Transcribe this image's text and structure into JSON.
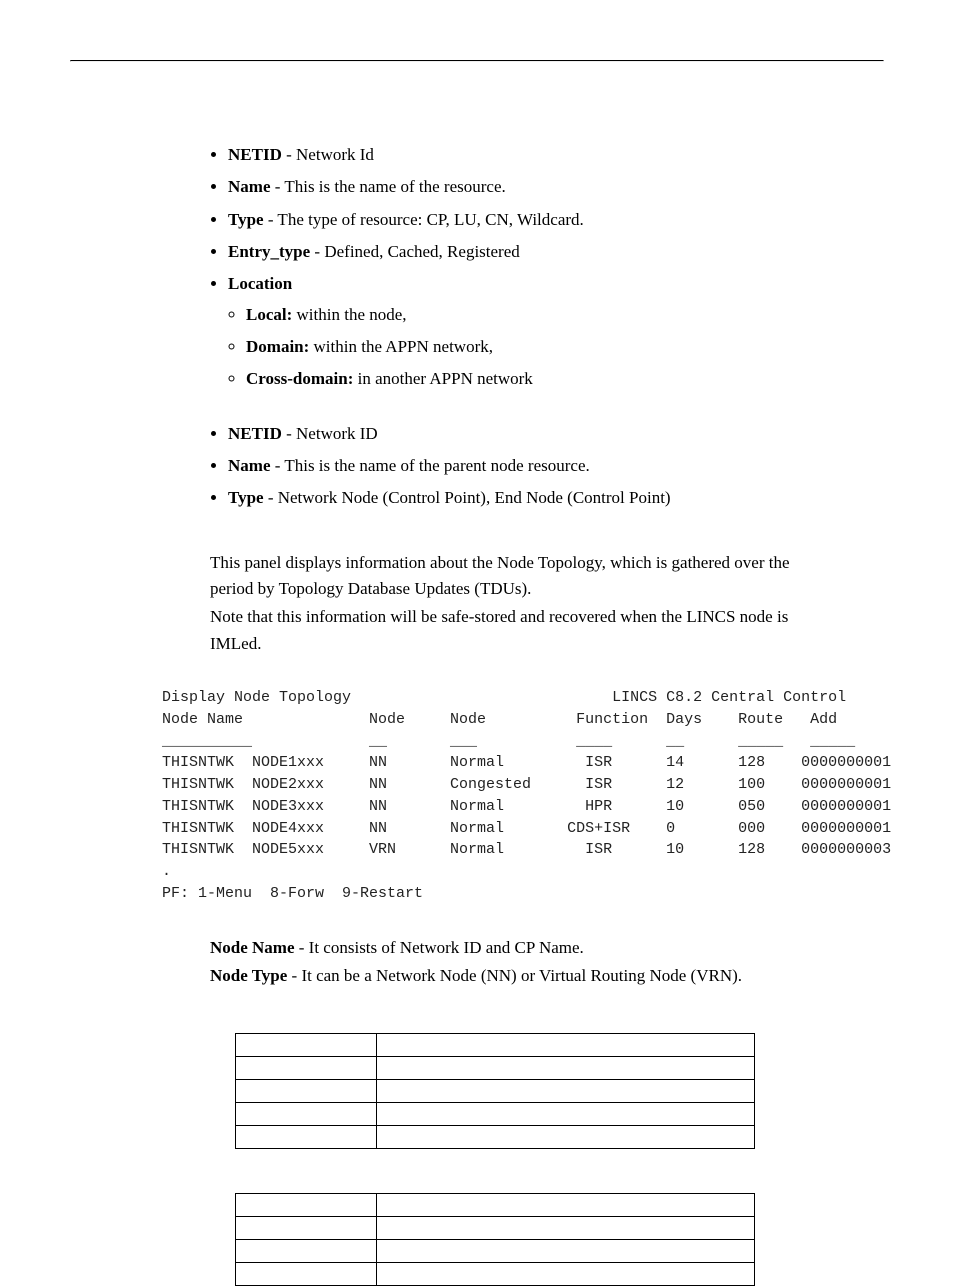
{
  "list1": {
    "items": [
      {
        "term": "NETID",
        "text": " - Network Id"
      },
      {
        "term": "Name",
        "text": " - This is the name of the resource."
      },
      {
        "term": "Type",
        "text": " - The type of resource: CP, LU, CN, Wildcard."
      },
      {
        "term": "Entry_type",
        "text": " - Defined, Cached, Registered"
      },
      {
        "term": "Location",
        "sub": [
          {
            "term": "Local:",
            "text": " within the node,"
          },
          {
            "term": "Domain:",
            "text": " within the APPN network,"
          },
          {
            "term": "Cross-domain:",
            "text": " in another APPN network"
          }
        ]
      }
    ]
  },
  "list2": {
    "items": [
      {
        "term": "NETID",
        "text": " - Network ID"
      },
      {
        "term": "Name",
        "text": " - This is the name of the parent node resource."
      },
      {
        "term": "Type",
        "text": " - Network Node (Control Point), End Node (Control Point)"
      }
    ]
  },
  "paragraph1": "This panel displays information about the Node Topology, which is gathered over the period by Topology Database Updates (TDUs).",
  "paragraph2": "Note that this information will be safe-stored and recovered when the LINCS node is IMLed.",
  "terminal": {
    "title_left": "Display Node Topology",
    "title_right": "LINCS C8.2 Central Control",
    "headers": [
      "Node Name",
      "Node",
      "Node",
      "Function",
      "Days",
      "Route",
      "Add"
    ],
    "rows": [
      [
        "THISNTWK",
        "NODE1xxx",
        "NN",
        "Normal",
        "ISR",
        "14",
        "128",
        "0000000001"
      ],
      [
        "THISNTWK",
        "NODE2xxx",
        "NN",
        "Congested",
        "ISR",
        "12",
        "100",
        "0000000001"
      ],
      [
        "THISNTWK",
        "NODE3xxx",
        "NN",
        "Normal",
        "HPR",
        "10",
        "050",
        "0000000001"
      ],
      [
        "THISNTWK",
        "NODE4xxx",
        "NN",
        "Normal",
        "CDS+ISR",
        "0",
        "000",
        "0000000001"
      ],
      [
        "THISNTWK",
        "NODE5xxx",
        "VRN",
        "Normal",
        "ISR",
        "10",
        "128",
        "0000000003"
      ]
    ],
    "footer": "PF: 1-Menu  8-Forw  9-Restart"
  },
  "descriptions": [
    {
      "term": "Node Name",
      "text": " - It consists of Network ID and CP Name."
    },
    {
      "term": "Node Type",
      "text": " - It can be a Network Node (NN) or Virtual Routing Node (VRN)."
    }
  ],
  "table1_rows": 5,
  "table2_rows": 4
}
